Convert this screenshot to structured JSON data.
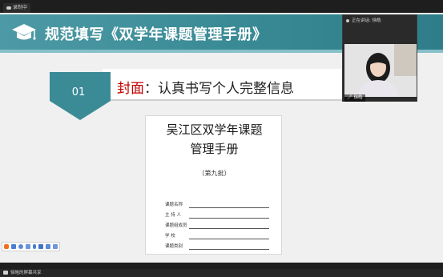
{
  "recording": {
    "label": "录制中",
    "icon": "cloud-icon"
  },
  "slide": {
    "banner_title": "规范填写《双学年课题管理手册》",
    "banner_icon": "graduation-cap-icon",
    "section_number": "01",
    "section_title_red": "封面",
    "section_title_rest": "：认真书写个人完整信息",
    "accent_color": "#3a8b96"
  },
  "document": {
    "title_line1": "吴江区双学年课题",
    "title_line2": "管理手册",
    "batch": "（第九批）",
    "fields": [
      {
        "label": "课题名称"
      },
      {
        "label": "主 持 人"
      },
      {
        "label": "课题组成员"
      },
      {
        "label": "学     校"
      },
      {
        "label": "课题类别"
      }
    ]
  },
  "toolbar": {
    "icons": [
      "sogou-s-icon",
      "chinese-input-icon",
      "moon-icon",
      "punctuation-icon",
      "mic-icon",
      "keyboard-icon",
      "shirt-icon",
      "grid-icon"
    ]
  },
  "video": {
    "header": "正在讲话: 徐皓",
    "participant_name": "徐皓",
    "mic_icon": "mic-icon"
  },
  "statusbar": {
    "text": "徐皓的屏幕共享"
  }
}
